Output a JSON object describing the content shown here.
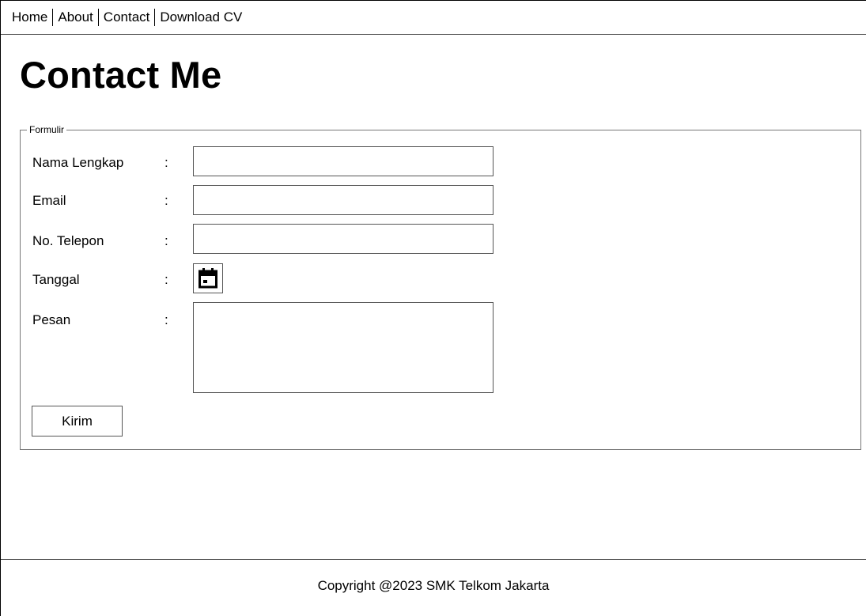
{
  "nav": {
    "items": [
      {
        "label": "Home"
      },
      {
        "label": "About"
      },
      {
        "label": "Contact"
      },
      {
        "label": "Download CV"
      }
    ]
  },
  "page": {
    "title": "Contact Me"
  },
  "form": {
    "legend": "Formulir",
    "colon": ":",
    "fields": {
      "name": {
        "label": "Nama Lengkap",
        "value": "",
        "placeholder": ""
      },
      "email": {
        "label": "Email",
        "value": "",
        "placeholder": ""
      },
      "phone": {
        "label": "No. Telepon",
        "value": "",
        "placeholder": ""
      },
      "date": {
        "label": "Tanggal",
        "icon": "calendar-icon"
      },
      "message": {
        "label": "Pesan",
        "value": "",
        "placeholder": ""
      }
    },
    "submit_label": "Kirim"
  },
  "footer": {
    "text": "Copyright @2023 SMK Telkom Jakarta"
  }
}
